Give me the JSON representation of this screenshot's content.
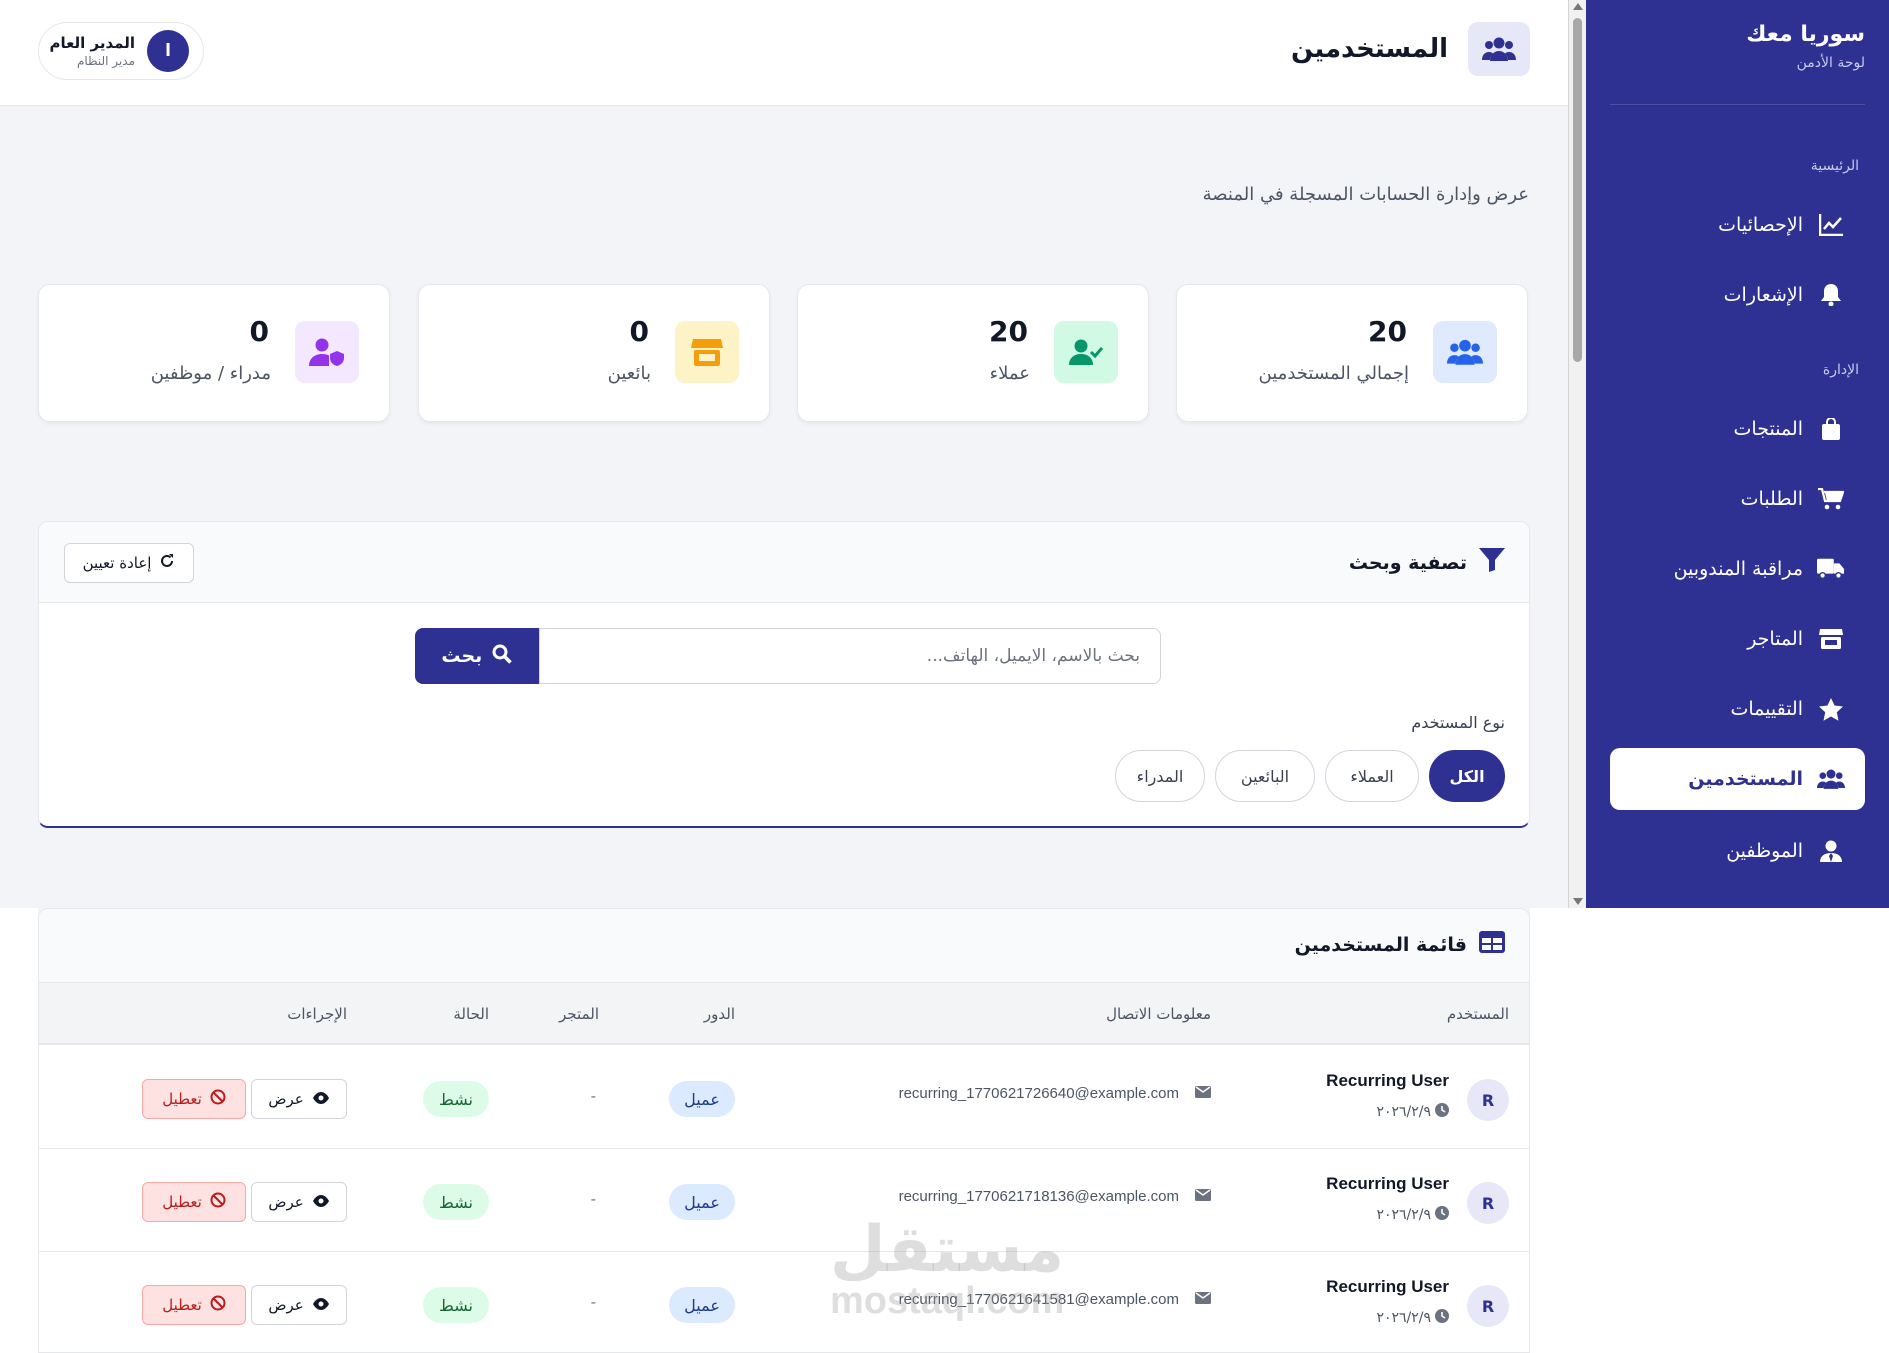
{
  "sidebar": {
    "brand_title": "سوريا معك",
    "brand_sub": "لوحة الأدمن",
    "section_main": "الرئيسية",
    "section_admin": "الإدارة",
    "items": [
      {
        "label": "الإحصائيات",
        "icon": "chart-line-icon"
      },
      {
        "label": "الإشعارات",
        "icon": "bell-icon"
      },
      {
        "label": "المنتجات",
        "icon": "shopping-bag-icon"
      },
      {
        "label": "الطلبات",
        "icon": "cart-icon"
      },
      {
        "label": "مراقبة المندوبين",
        "icon": "truck-icon"
      },
      {
        "label": "المتاجر",
        "icon": "store-icon"
      },
      {
        "label": "التقييمات",
        "icon": "star-icon"
      },
      {
        "label": "المستخدمين",
        "icon": "users-icon",
        "active": true
      },
      {
        "label": "الموظفين",
        "icon": "user-tie-icon"
      }
    ]
  },
  "header": {
    "title": "المستخدمين",
    "user_name": "المدير العام",
    "user_role": "مدير النظام",
    "user_initial": "ا"
  },
  "subtitle": "عرض وإدارة الحسابات المسجلة في المنصة",
  "stats": [
    {
      "value": "20",
      "label": "إجمالي المستخدمين",
      "color": "#2563eb"
    },
    {
      "value": "20",
      "label": "عملاء",
      "color": "#059669"
    },
    {
      "value": "0",
      "label": "بائعين",
      "color": "#f59e0b"
    },
    {
      "value": "0",
      "label": "مدراء / موظفين",
      "color": "#9333ea"
    }
  ],
  "filter": {
    "title": "تصفية وبحث",
    "reset_label": "إعادة تعيين",
    "search_placeholder": "بحث بالاسم، الايميل، الهاتف...",
    "search_button": "بحث",
    "type_label": "نوع المستخدم",
    "chips": [
      "الكل",
      "العملاء",
      "البائعين",
      "المدراء"
    ],
    "active_chip": "الكل"
  },
  "table": {
    "title": "قائمة المستخدمين",
    "columns": [
      "المستخدم",
      "معلومات الاتصال",
      "الدور",
      "المتجر",
      "الحالة",
      "الإجراءات"
    ],
    "view_label": "عرض",
    "disable_label": "تعطيل",
    "rows": [
      {
        "initial": "R",
        "name": "Recurring User",
        "date": "٢٠٢٦/٢/٩",
        "email": "recurring_1770621726640@example.com",
        "role": "عميل",
        "store": "-",
        "status": "نشط"
      },
      {
        "initial": "R",
        "name": "Recurring User",
        "date": "٢٠٢٦/٢/٩",
        "email": "recurring_1770621718136@example.com",
        "role": "عميل",
        "store": "-",
        "status": "نشط"
      },
      {
        "initial": "R",
        "name": "Recurring User",
        "date": "٢٠٢٦/٢/٩",
        "email": "recurring_1770621641581@example.com",
        "role": "عميل",
        "store": "-",
        "status": "نشط"
      }
    ]
  },
  "watermark": {
    "arabic": "مستقل",
    "latin": "mostaql.com"
  }
}
